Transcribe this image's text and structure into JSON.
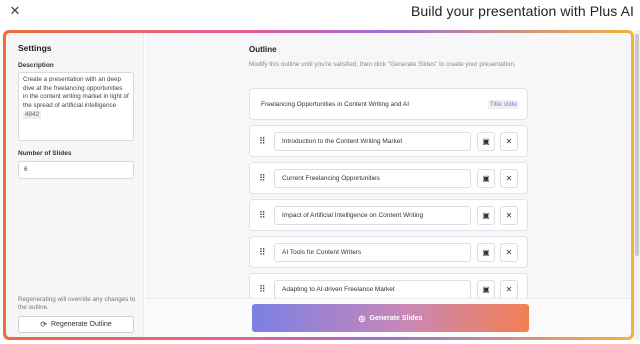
{
  "window": {
    "title": "Build your presentation with Plus AI",
    "close_icon": "close-icon"
  },
  "settings": {
    "title": "Settings",
    "description_label": "Description",
    "description_value": "Create a presentation with an deep dive at the freelancing opportunities in the content writing market in light of the spread of artificial intelligence",
    "char_count": "4842",
    "num_slides_label": "Number of Slides",
    "num_slides_value": "6",
    "regenerate_note": "Regenerating will override any changes to the outline.",
    "regenerate_label": "Regenerate Outline"
  },
  "outline": {
    "title": "Outline",
    "hint": "Modify this outline until you're satisfied, then click \"Generate Slides\" to create your presentation.",
    "title_slide": {
      "text": "Freelancing Opportunities in Content Writing and AI",
      "badge": "Title slide"
    },
    "slides": [
      {
        "text": "Introduction to the Content Writing Market"
      },
      {
        "text": "Current Freelancing Opportunities"
      },
      {
        "text": "Impact of Artificial Intelligence on Content Writing"
      },
      {
        "text": "AI Tools for Content Writers"
      },
      {
        "text": "Adapting to AI-driven Freelance Market"
      }
    ]
  },
  "footer": {
    "generate_label": "Generate Slides"
  },
  "colors": {
    "gradient_start": "#7b7fe4",
    "gradient_end": "#f27f53",
    "frame_orange": "#f26b3a",
    "frame_yellow": "#f3b33b"
  }
}
